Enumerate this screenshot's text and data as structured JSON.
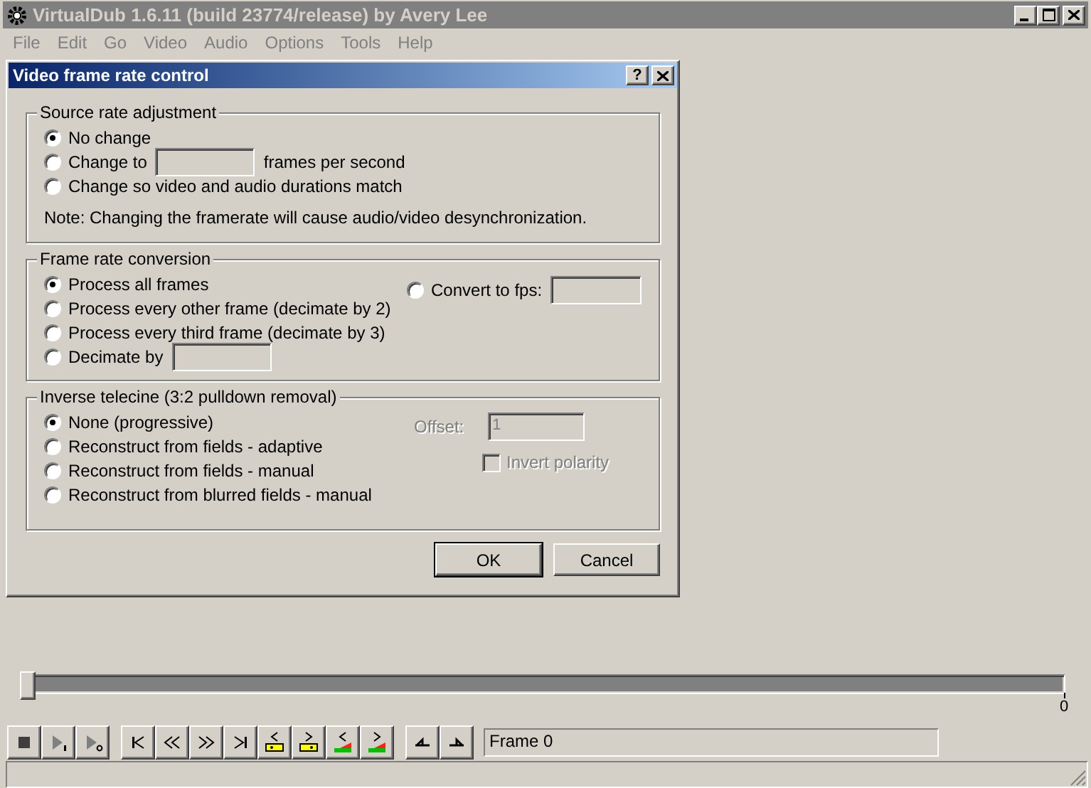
{
  "window": {
    "title": "VirtualDub 1.6.11 (build 23774/release) by Avery Lee"
  },
  "menu": [
    "File",
    "Edit",
    "Go",
    "Video",
    "Audio",
    "Options",
    "Tools",
    "Help"
  ],
  "dialog": {
    "title": "Video frame rate control",
    "help_button": "?",
    "groups": [
      {
        "title": "Source rate adjustment",
        "options": [
          {
            "kind": "radio",
            "label": "No change",
            "selected": true
          },
          {
            "kind": "radio_field",
            "label": "Change to",
            "suffix": "frames per second",
            "selected": false,
            "field_disabled": true
          },
          {
            "kind": "radio",
            "label": "Change so video and audio durations match",
            "selected": false
          }
        ],
        "note": "Note: Changing the framerate will cause audio/video desynchronization."
      },
      {
        "title": "Frame rate conversion",
        "options": [
          {
            "kind": "radio",
            "label": "Process all frames",
            "selected": true
          },
          {
            "kind": "radio",
            "label": "Process every other frame (decimate by 2)",
            "selected": false
          },
          {
            "kind": "radio",
            "label": "Process every third frame (decimate by 3)",
            "selected": false
          },
          {
            "kind": "radio_field",
            "label": "Decimate by",
            "selected": false,
            "field_disabled": true
          }
        ],
        "side": {
          "kind": "radio_field",
          "label": "Convert to fps:",
          "selected": false,
          "field_disabled": true
        }
      },
      {
        "title": "Inverse telecine (3:2 pulldown removal)",
        "options": [
          {
            "kind": "radio",
            "label": "None (progressive)",
            "selected": true
          },
          {
            "kind": "radio",
            "label": "Reconstruct from fields - adaptive",
            "selected": false
          },
          {
            "kind": "radio",
            "label": "Reconstruct from fields - manual",
            "selected": false
          },
          {
            "kind": "radio",
            "label": "Reconstruct from blurred fields - manual",
            "selected": false
          }
        ],
        "offset": {
          "label": "Offset:",
          "value": "1",
          "disabled": true
        },
        "invert_polarity": {
          "label": "Invert polarity",
          "checked": false,
          "disabled": true
        }
      }
    ],
    "buttons": [
      {
        "label": "OK",
        "default": true
      },
      {
        "label": "Cancel",
        "default": false
      }
    ]
  },
  "position": {
    "level": 0,
    "tick_label": "0"
  },
  "frame_field": "Frame 0"
}
